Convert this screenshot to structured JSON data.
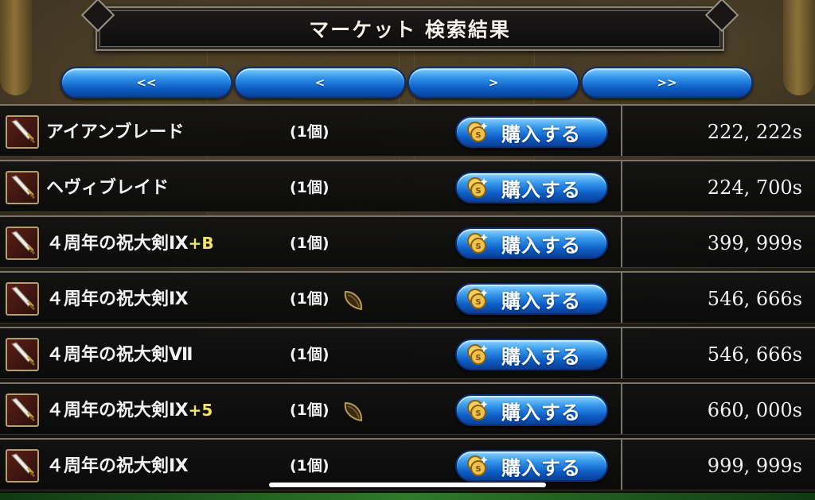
{
  "header": {
    "title": "マーケット  検索結果"
  },
  "nav": {
    "first": "<<",
    "prev": "<",
    "next": ">",
    "last": ">>"
  },
  "buy_label": "購入する",
  "icons": {
    "item": "sword-icon",
    "buy": "coin-icon",
    "extra": "seed-icon"
  },
  "colors": {
    "button_blue": "#0c5dc4",
    "suffix_yellow": "#f2e26a",
    "row_bg": "#121212"
  },
  "rows": [
    {
      "name": "アイアンブレード",
      "suffix": "",
      "quantity": "(1個)",
      "has_seed": false,
      "price": "222, 222s"
    },
    {
      "name": "ヘヴィブレイド",
      "suffix": "",
      "quantity": "(1個)",
      "has_seed": false,
      "price": "224, 700s"
    },
    {
      "name": "４周年の祝大剣Ⅸ",
      "suffix": "+B",
      "quantity": "(1個)",
      "has_seed": false,
      "price": "399, 999s"
    },
    {
      "name": "４周年の祝大剣Ⅸ",
      "suffix": "",
      "quantity": "(1個)",
      "has_seed": true,
      "price": "546, 666s"
    },
    {
      "name": "４周年の祝大剣Ⅶ",
      "suffix": "",
      "quantity": "(1個)",
      "has_seed": false,
      "price": "546, 666s"
    },
    {
      "name": "４周年の祝大剣Ⅸ",
      "suffix": "+5",
      "quantity": "(1個)",
      "has_seed": true,
      "price": "660, 000s"
    },
    {
      "name": "４周年の祝大剣Ⅸ",
      "suffix": "",
      "quantity": "(1個)",
      "has_seed": false,
      "price": "999, 999s"
    }
  ]
}
